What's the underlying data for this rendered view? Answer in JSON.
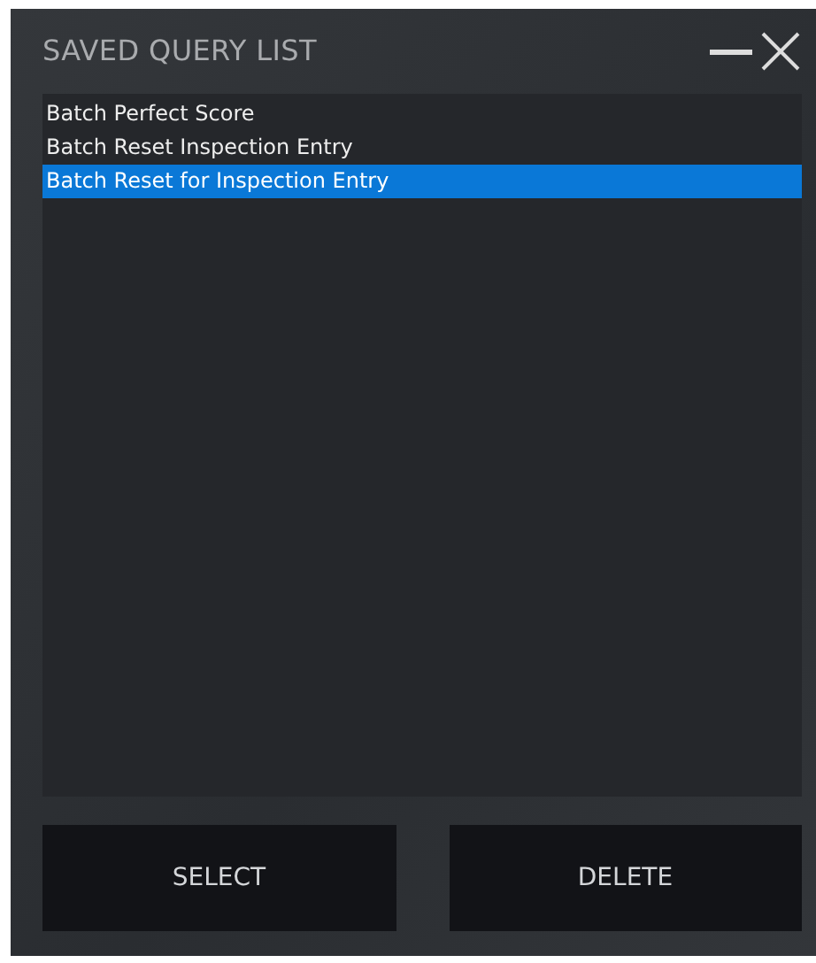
{
  "window": {
    "title": "SAVED QUERY LIST"
  },
  "queries": [
    {
      "label": "Batch Perfect Score",
      "selected": false
    },
    {
      "label": "Batch Reset Inspection Entry",
      "selected": false
    },
    {
      "label": "Batch Reset for Inspection Entry",
      "selected": true
    }
  ],
  "buttons": [
    "SELECT",
    "DELETE"
  ]
}
